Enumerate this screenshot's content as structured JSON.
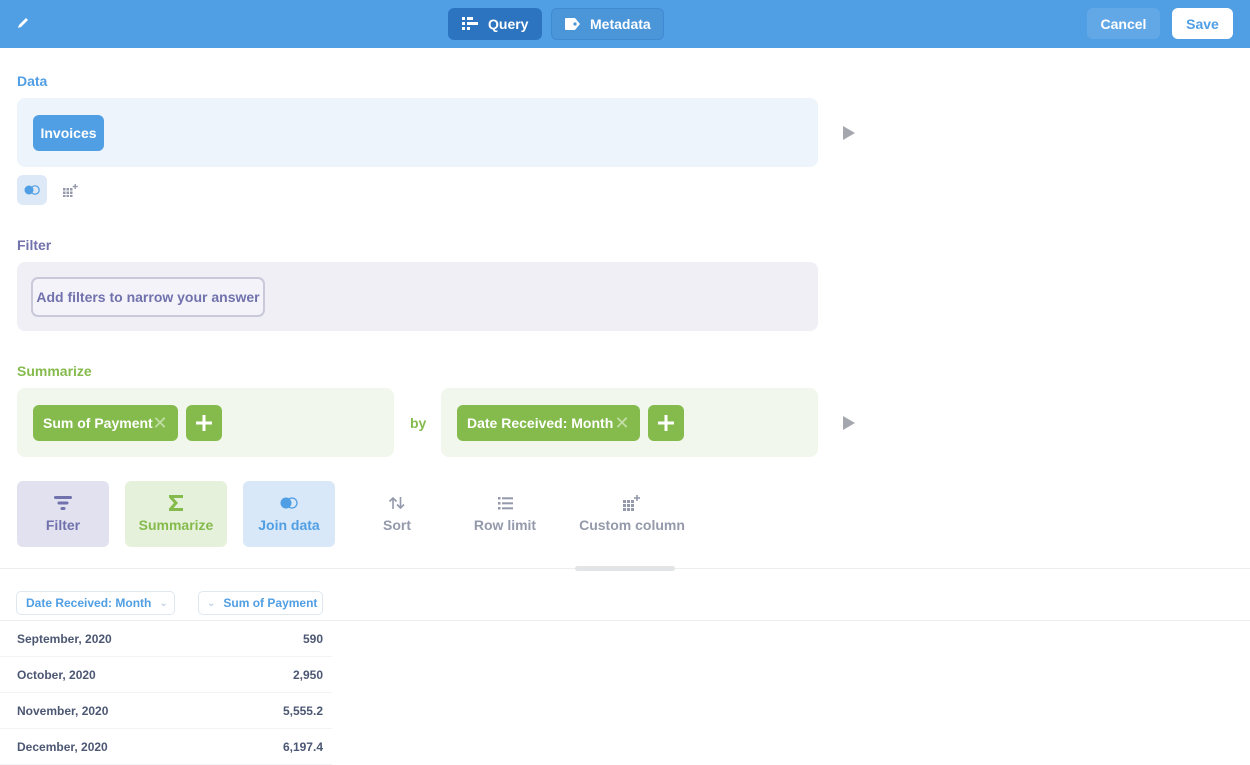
{
  "header": {
    "edit_icon": "pencil-icon",
    "tabs": [
      {
        "label": "Query",
        "icon": "notebook-icon",
        "active": true
      },
      {
        "label": "Metadata",
        "icon": "tag-icon",
        "active": false
      }
    ],
    "cancel_label": "Cancel",
    "save_label": "Save",
    "colors": {
      "brand": "#509ee3",
      "active_tab": "#2d74c0"
    }
  },
  "data_section": {
    "label": "Data",
    "source": "Invoices",
    "tools": [
      {
        "icon": "join-icon",
        "active": true
      },
      {
        "icon": "add-column-icon",
        "active": false
      }
    ]
  },
  "filter_section": {
    "label": "Filter",
    "placeholder_button": "Add filters to narrow your answer"
  },
  "summarize_section": {
    "label": "Summarize",
    "metrics": [
      {
        "label": "Sum of Payment"
      }
    ],
    "by_label": "by",
    "breakouts": [
      {
        "label": "Date Received: Month"
      }
    ],
    "remove_glyph": "✕",
    "colors": {
      "summarize": "#84bb4c",
      "filter": "#7172ad"
    }
  },
  "actions": [
    {
      "label": "Filter",
      "icon": "filter-icon"
    },
    {
      "label": "Summarize",
      "icon": "sum-icon"
    },
    {
      "label": "Join data",
      "icon": "join-icon"
    },
    {
      "label": "Sort",
      "icon": "sort-icon"
    },
    {
      "label": "Row limit",
      "icon": "list-icon"
    },
    {
      "label": "Custom column",
      "icon": "add-column-icon"
    }
  ],
  "preview_table": {
    "columns": [
      "Date Received: Month",
      "Sum of Payment"
    ],
    "rows": [
      [
        "September, 2020",
        "590"
      ],
      [
        "October, 2020",
        "2,950"
      ],
      [
        "November, 2020",
        "5,555.2"
      ],
      [
        "December, 2020",
        "6,197.4"
      ]
    ]
  }
}
